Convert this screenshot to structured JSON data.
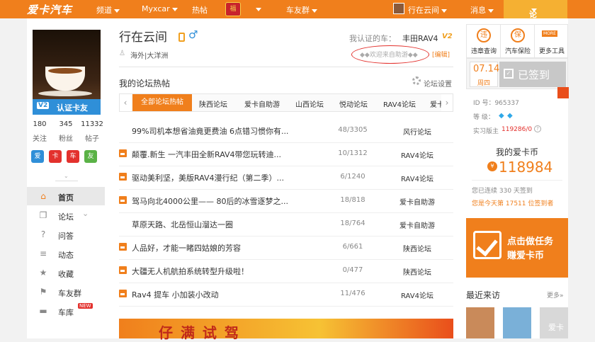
{
  "topbar": {
    "logo": "爱卡汽车",
    "nav": [
      "频道",
      "Myxcar",
      "热帖",
      "车友群"
    ],
    "lucky_icon_text": "福",
    "username": "行在云间",
    "messages": "消息",
    "guide": "论坛导航"
  },
  "sidebar": {
    "v2_tag": "V2",
    "v2_label": "认证卡友",
    "stats": [
      {
        "num": "180",
        "label": "关注"
      },
      {
        "num": "345",
        "label": "粉丝"
      },
      {
        "num": "11332",
        "label": "帖子"
      }
    ],
    "badges": [
      {
        "text": "爱",
        "color": "#2f8fd8"
      },
      {
        "text": "卡",
        "color": "#e3312d"
      },
      {
        "text": "车",
        "color": "#e3312d"
      },
      {
        "text": "友",
        "color": "#5ab246"
      }
    ],
    "menu": [
      {
        "icon": "home-icon",
        "glyph": "⌂",
        "label": "首页",
        "active": true
      },
      {
        "icon": "forum-icon",
        "glyph": "❐",
        "label": "论坛"
      },
      {
        "icon": "question-icon",
        "glyph": "?",
        "label": "问答"
      },
      {
        "icon": "feed-icon",
        "glyph": "≡",
        "label": "动态"
      },
      {
        "icon": "star-icon",
        "glyph": "★",
        "label": "收藏"
      },
      {
        "icon": "flag-icon",
        "glyph": "⚑",
        "label": "车友群"
      },
      {
        "icon": "car-icon",
        "glyph": "▬",
        "label": "车库",
        "new": "NEW"
      }
    ]
  },
  "profile": {
    "name": "行在云间",
    "location": "海外|大洋洲",
    "cert_label": "我认证的车：",
    "cert_value": "丰田RAV4",
    "v2": "V2",
    "signature": "◆◆欢迎来自助游◆◆",
    "signature_edit": "[编辑]"
  },
  "hotposts": {
    "title": "我的论坛热帖",
    "settings": "论坛设置",
    "tabs": [
      "全部论坛热帖",
      "陕西论坛",
      "爱卡自助游",
      "山西论坛",
      "悦动论坛",
      "RAV4论坛",
      "爱卡"
    ],
    "posts": [
      {
        "title": "99%司机本想省油竟更费油 6点错习惯你有...",
        "count": "48/3305",
        "forum": "风行论坛",
        "pic": false
      },
      {
        "title": "颠覆.新生 一汽丰田全新RAV4带您玩转迪...",
        "count": "10/1312",
        "forum": "RAV4论坛",
        "pic": true
      },
      {
        "title": "驱动美利坚，美版RAV4漫行纪（第二季）...",
        "count": "6/1240",
        "forum": "RAV4论坛",
        "pic": true
      },
      {
        "title": "驾马向北4000公里—— 80后的冰雪逐梦之...",
        "count": "18/818",
        "forum": "爱卡自助游",
        "pic": true
      },
      {
        "title": "草原天路、北岳恒山溜达一圈",
        "count": "18/764",
        "forum": "爱卡自助游",
        "pic": false
      },
      {
        "title": "人品好，才能一睹四姑娘的芳容",
        "count": "6/661",
        "forum": "陕西论坛",
        "pic": true
      },
      {
        "title": "大疆无人机航拍系统转型升级啦！",
        "count": "0/477",
        "forum": "陕西论坛",
        "pic": true
      },
      {
        "title": "Rav4 提车  小加装小改动",
        "count": "11/476",
        "forum": "RAV4论坛",
        "pic": true
      }
    ]
  },
  "right": {
    "tools": [
      {
        "icon": "violation-icon",
        "glyph": "违",
        "label": "违章查询"
      },
      {
        "icon": "insurance-icon",
        "glyph": "保",
        "label": "汽车保险"
      },
      {
        "icon": "more-tools-icon",
        "glyph": "",
        "label": "更多工具",
        "tag": "MORE"
      }
    ],
    "date": "07.14",
    "weekday": "周四",
    "signed": "已签到",
    "id_label": "ID 号：965337",
    "level_label": "等    级：",
    "gems": [
      "◆",
      "◆"
    ],
    "intern_label": "实习版主",
    "intern_value": "119286/0",
    "coin_title": "我的爱卡币",
    "coin_icon": "¥",
    "coin_value": "118984",
    "continuous": "您已连续 330 天签到",
    "today_rank": "您是今天第 17511 位签到者",
    "task_line1": "点击做任务",
    "task_line2": "赚爱卡币",
    "visitors_title": "最近来访",
    "visitors_more": "更多»",
    "visitors": [
      {
        "color": "#c98a5a"
      },
      {
        "color": "#7ab0d8"
      },
      {
        "color": "#d8d8d8"
      }
    ]
  },
  "banner": {
    "text": "仔 满 试 驾"
  }
}
